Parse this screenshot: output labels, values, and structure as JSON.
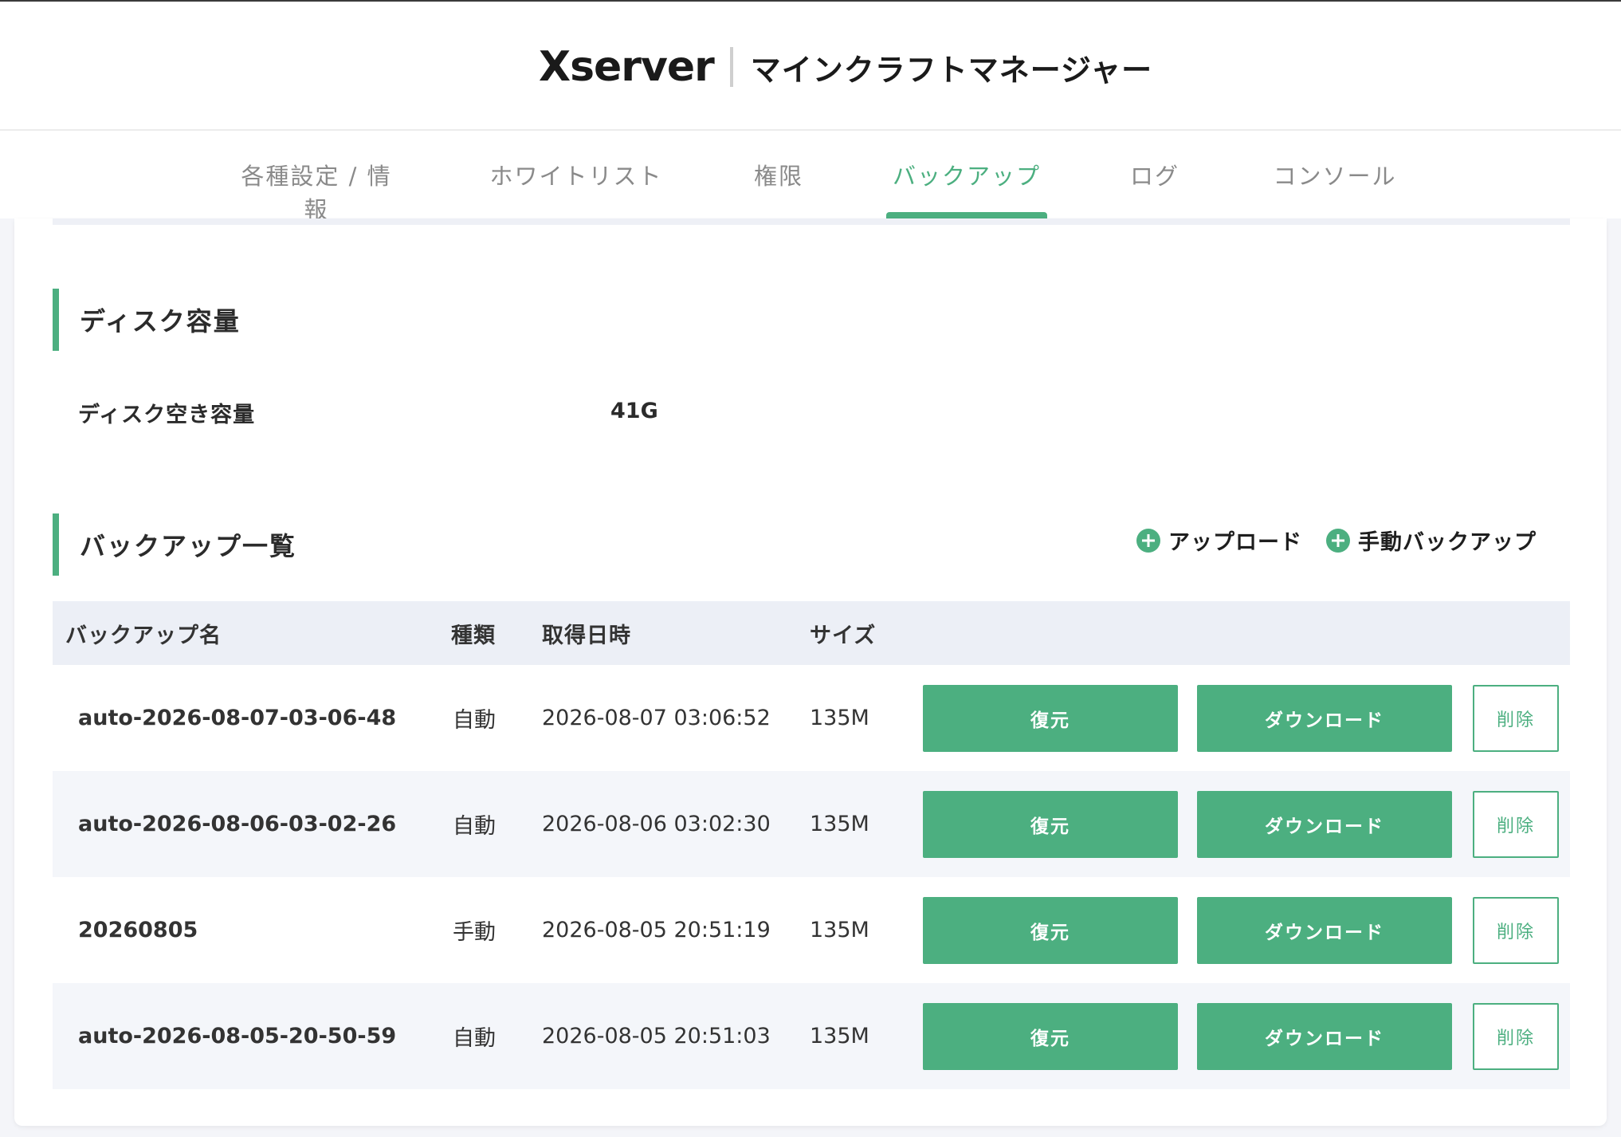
{
  "header": {
    "logo_text": "Xserver",
    "app_title": "マインクラフトマネージャー"
  },
  "tabs": [
    {
      "label": "各種設定 / 情報",
      "active": false
    },
    {
      "label": "ホワイトリスト",
      "active": false
    },
    {
      "label": "権限",
      "active": false
    },
    {
      "label": "バックアップ",
      "active": true
    },
    {
      "label": "ログ",
      "active": false
    },
    {
      "label": "コンソール",
      "active": false
    }
  ],
  "disk": {
    "section_title": "ディスク容量",
    "free_label": "ディスク空き容量",
    "free_value": "41G"
  },
  "backups": {
    "section_title": "バックアップ一覧",
    "upload_label": "アップロード",
    "manual_backup_label": "手動バックアップ",
    "columns": [
      "バックアップ名",
      "種類",
      "取得日時",
      "サイズ"
    ],
    "restore_label": "復元",
    "download_label": "ダウンロード",
    "delete_label": "削除",
    "rows": [
      {
        "name": "auto-2026-08-07-03-06-48",
        "type": "自動",
        "datetime": "2026-08-07 03:06:52",
        "size": "135M"
      },
      {
        "name": "auto-2026-08-06-03-02-26",
        "type": "自動",
        "datetime": "2026-08-06 03:02:30",
        "size": "135M"
      },
      {
        "name": "20260805",
        "type": "手動",
        "datetime": "2026-08-05 20:51:19",
        "size": "135M"
      },
      {
        "name": "auto-2026-08-05-20-50-59",
        "type": "自動",
        "datetime": "2026-08-05 20:51:03",
        "size": "135M"
      }
    ]
  },
  "colors": {
    "accent": "#4caf80",
    "header_row_bg": "#eceff6",
    "alt_row_bg": "#f4f6fa"
  }
}
